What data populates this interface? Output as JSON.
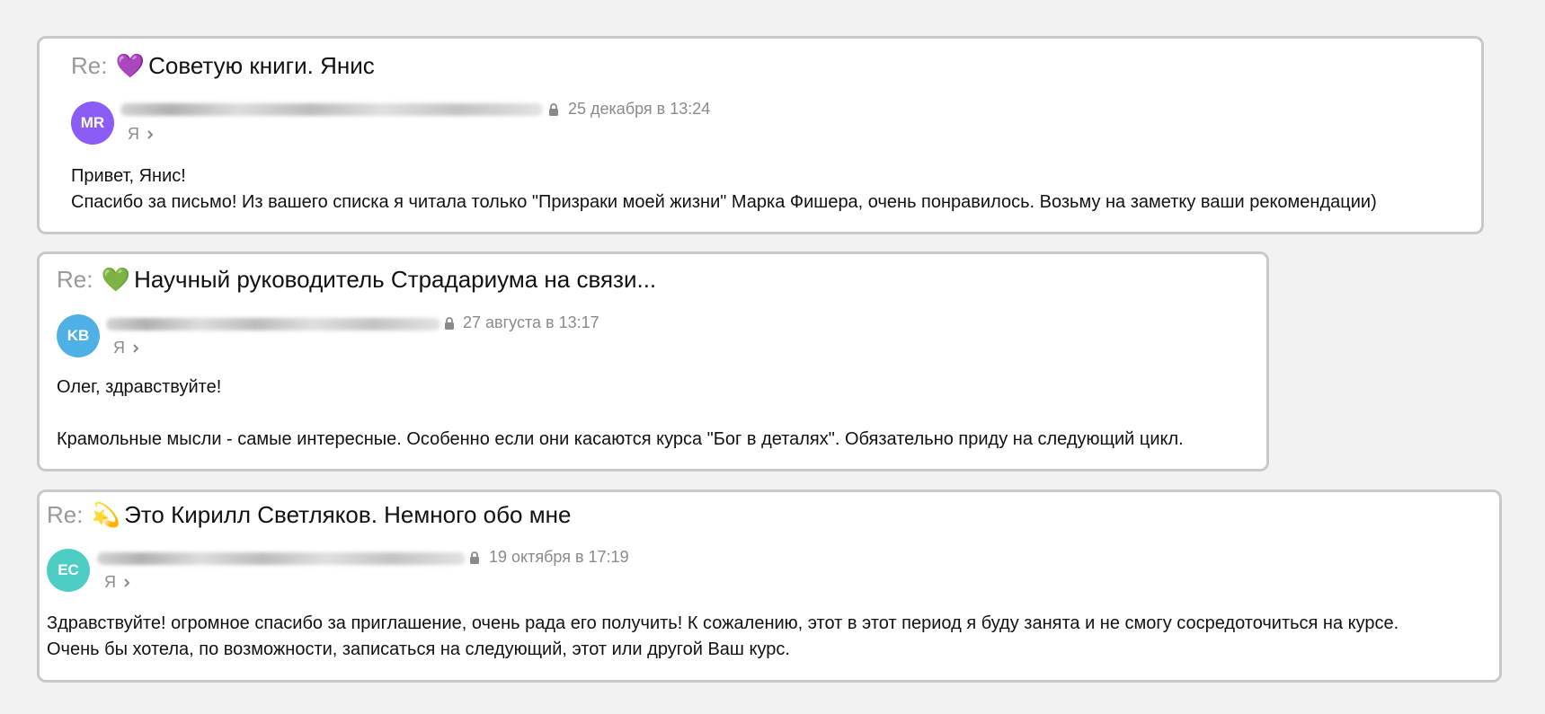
{
  "colors": {
    "page_bg": "#f2f2f2",
    "card_border": "#c9c9c9",
    "re_prefix": "#999999",
    "meta_text": "#8a8a8a"
  },
  "messages": [
    {
      "re": "Re:",
      "emoji": "💜",
      "subject": "Советую книги. Янис",
      "avatar_initials": "MR",
      "avatar_color": "#8b5cf6",
      "date": "25 декабря в 13:24",
      "recipient": "Я",
      "body": [
        "Привет, Янис!",
        "Спасибо за письмо! Из вашего списка я читала только \"Призраки моей жизни\" Марка Фишера, очень понравилось. Возьму на заметку ваши рекомендации)"
      ]
    },
    {
      "re": "Re:",
      "emoji": "💚",
      "subject": "Научный руководитель Страдариума на связи...",
      "avatar_initials": "KB",
      "avatar_color": "#4fb0e6",
      "date": "27 августа в 13:17",
      "recipient": "Я",
      "body": [
        "Олег, здравствуйте!",
        "",
        "Крамольные мысли - самые интересные. Особенно если они касаются курса \"Бог в деталях\". Обязательно приду на следующий цикл."
      ]
    },
    {
      "re": "Re:",
      "emoji": "💫",
      "subject": "Это Кирилл Светляков. Немного обо мне",
      "avatar_initials": "EC",
      "avatar_color": "#4ecdc4",
      "date": "19 октября в 17:19",
      "recipient": "Я",
      "body": [
        "Здравствуйте! огромное спасибо за приглашение, очень рада его получить! К сожалению, этот в этот период я буду занята и не смогу сосредоточиться на курсе.",
        "Очень бы хотела, по возможности, записаться на следующий, этот или другой Ваш курс."
      ]
    }
  ]
}
